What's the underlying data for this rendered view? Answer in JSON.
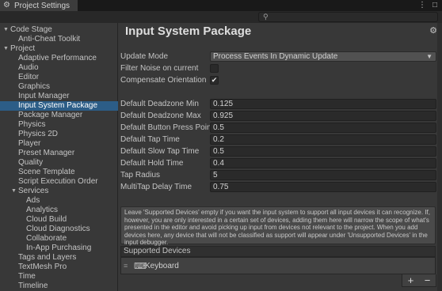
{
  "window": {
    "title": "Project Settings",
    "menu_icon": "kebab-icon",
    "close_icon": "close-icon"
  },
  "search": {
    "placeholder": "",
    "icon": "search-icon"
  },
  "sidebar": {
    "items": [
      {
        "label": "Code Stage",
        "expanded": true
      },
      {
        "label": "Anti-Cheat Toolkit"
      },
      {
        "label": "Project",
        "expanded": true
      },
      {
        "label": "Adaptive Performance"
      },
      {
        "label": "Audio"
      },
      {
        "label": "Editor"
      },
      {
        "label": "Graphics"
      },
      {
        "label": "Input Manager"
      },
      {
        "label": "Input System Package",
        "selected": true
      },
      {
        "label": "Package Manager"
      },
      {
        "label": "Physics"
      },
      {
        "label": "Physics 2D"
      },
      {
        "label": "Player"
      },
      {
        "label": "Preset Manager"
      },
      {
        "label": "Quality"
      },
      {
        "label": "Scene Template"
      },
      {
        "label": "Script Execution Order"
      },
      {
        "label": "Services",
        "expanded": true
      },
      {
        "label": "Ads"
      },
      {
        "label": "Analytics"
      },
      {
        "label": "Cloud Build"
      },
      {
        "label": "Cloud Diagnostics"
      },
      {
        "label": "Collaborate"
      },
      {
        "label": "In-App Purchasing"
      },
      {
        "label": "Tags and Layers"
      },
      {
        "label": "TextMesh Pro"
      },
      {
        "label": "Time"
      },
      {
        "label": "Timeline"
      }
    ]
  },
  "main": {
    "title": "Input System Package",
    "update_mode_label": "Update Mode",
    "update_mode_value": "Process Events In Dynamic Update",
    "filter_noise_label": "Filter Noise on current",
    "filter_noise_checked": false,
    "compensate_orientation_label": "Compensate Orientation",
    "compensate_orientation_checked": true,
    "check_mark": "✔",
    "fields": [
      {
        "label": "Default Deadzone Min",
        "value": "0.125"
      },
      {
        "label": "Default Deadzone Max",
        "value": "0.925"
      },
      {
        "label": "Default Button Press Point",
        "value": "0.5"
      },
      {
        "label": "Default Tap Time",
        "value": "0.2"
      },
      {
        "label": "Default Slow Tap Time",
        "value": "0.5"
      },
      {
        "label": "Default Hold Time",
        "value": "0.4"
      },
      {
        "label": "Tap Radius",
        "value": "5"
      },
      {
        "label": "MultiTap Delay Time",
        "value": "0.75"
      }
    ],
    "help_text": "Leave 'Supported Devices' empty if you want the input system to support all input devices it can recognize. If, however, you are only interested in a certain set of devices, adding them here will narrow the scope of what's presented in the editor and avoid picking up input from devices not relevant to the project. When you add devices here, any device that will not be classified as support will appear under 'Unsupported Devices' in the input debugger.",
    "supported_devices_label": "Supported Devices",
    "devices": [
      {
        "label": "Keyboard",
        "icon": "keyboard-icon"
      }
    ],
    "add_label": "+",
    "remove_label": "−"
  },
  "colors": {
    "background": "#383838",
    "selection": "#2c5d87",
    "field": "#2a2a2a"
  }
}
